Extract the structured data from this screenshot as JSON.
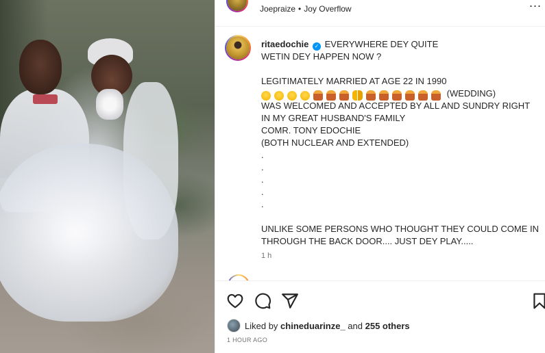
{
  "header": {
    "username": "Joepraize",
    "separator": "•",
    "audio": "Joy Overflow",
    "more_label": "..."
  },
  "caption": {
    "username": "ritaedochie",
    "verified_glyph": "✓",
    "first_line_text": " EVERYWHERE DEY QUITE",
    "lines": [
      "WETIN DEY HAPPEN NOW ?",
      "",
      "LEGITIMATELY MARRIED AT AGE 22 IN 1990"
    ],
    "emoji_line_suffix": "(WEDDING)",
    "emoji_icons": [
      "grinning-face-icon",
      "smiling-face-icon",
      "grinning-face-icon",
      "beaming-face-icon",
      "person-icon",
      "people-icon",
      "person-icon",
      "couple-icon",
      "person-icon",
      "people-icon",
      "person-icon",
      "people-icon",
      "people-icon",
      "person-icon"
    ],
    "lines_after": [
      "WAS WELCOMED AND ACCEPTED BY ALL AND SUNDRY RIGHT",
      "IN MY GREAT HUSBAND'S FAMILY",
      "COMR. TONY EDOCHIE",
      "(BOTH NUCLEAR AND EXTENDED)",
      ".",
      ".",
      ".",
      ".",
      ".",
      "",
      "UNLIKE SOME PERSONS WHO THOUGHT THEY COULD COME IN",
      "THROUGH THE BACK DOOR.... JUST DEY PLAY....."
    ],
    "time": "1 h"
  },
  "likes": {
    "prefix": "Liked by ",
    "user": "chineduarinze_",
    "middle": " and ",
    "count": "255 others"
  },
  "posted_ago": "1 HOUR AGO",
  "colors": {
    "verified": "#0095f6",
    "text": "#262626",
    "muted": "#737373"
  }
}
